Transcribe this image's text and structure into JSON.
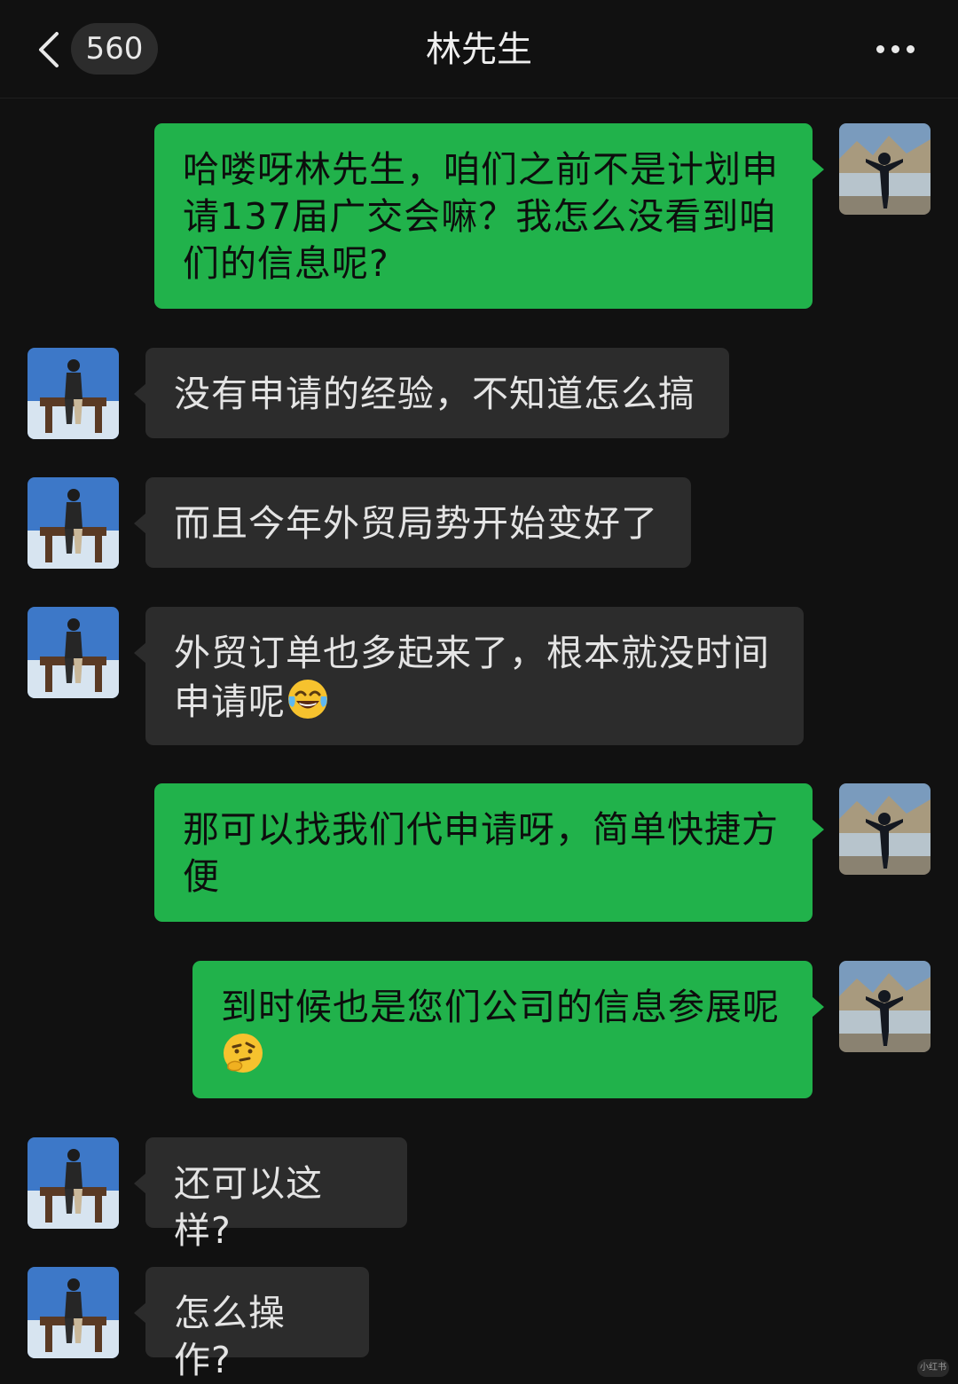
{
  "header": {
    "unread_count": "560",
    "title": "林先生"
  },
  "messages": [
    {
      "sender": "me",
      "text": "哈喽呀林先生，咱们之前不是计划申请137届广交会嘛？我怎么没看到咱们的信息呢?"
    },
    {
      "sender": "contact",
      "text": "没有申请的经验，不知道怎么搞"
    },
    {
      "sender": "contact",
      "text": "而且今年外贸局势开始变好了"
    },
    {
      "sender": "contact",
      "text": "外贸订单也多起来了，根本就没时间申请呢",
      "emoji": "tears-of-joy-emoji"
    },
    {
      "sender": "me",
      "text": "那可以找我们代申请呀，简单快捷方便"
    },
    {
      "sender": "me",
      "text": "到时候也是您们公司的信息参展呢",
      "emoji": "thinking-face-emoji"
    },
    {
      "sender": "contact",
      "text": "还可以这样?"
    },
    {
      "sender": "contact",
      "text": "怎么操作?"
    }
  ],
  "watermark": "小红书",
  "colors": {
    "background": "#111111",
    "outgoing_bubble": "#21b24b",
    "incoming_bubble": "#2c2c2c"
  }
}
